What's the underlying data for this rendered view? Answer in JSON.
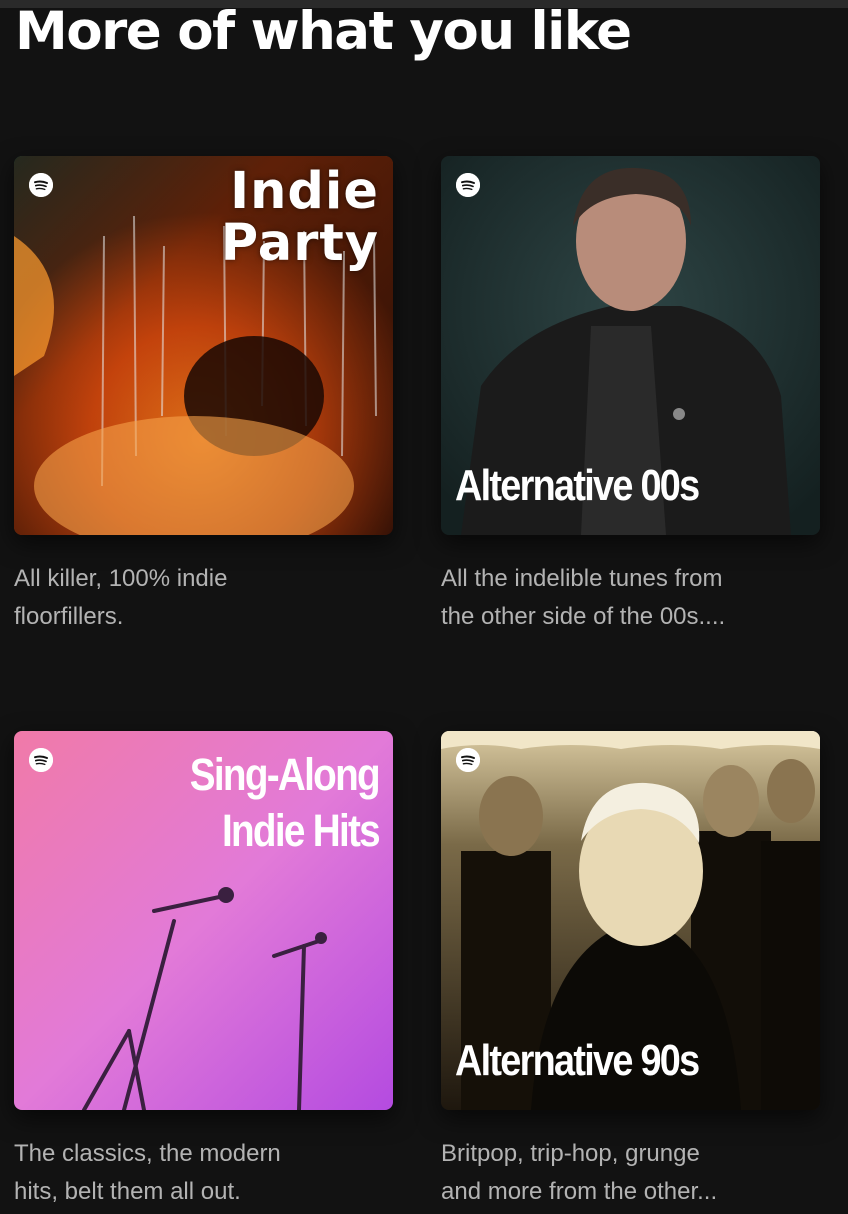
{
  "section": {
    "title": "More of what you like"
  },
  "playlists": [
    {
      "cover_title_line1": "Indie",
      "cover_title_line2": "Party",
      "description_line1": "All killer, 100% indie",
      "description_line2": "floorfillers."
    },
    {
      "cover_title": "Alternative 00s",
      "description_line1": "All the indelible tunes from",
      "description_line2": "the other side of the 00s...."
    },
    {
      "cover_title_line1": "Sing-Along",
      "cover_title_line2": "Indie Hits",
      "description_line1": "The classics, the modern",
      "description_line2": "hits, belt them all out."
    },
    {
      "cover_title": "Alternative 90s",
      "description_line1": "Britpop, trip-hop, grunge",
      "description_line2": "and more from the other..."
    }
  ],
  "icons": {
    "brand_logo": "spotify-logo-icon"
  },
  "colors": {
    "background": "#121212",
    "text_primary": "#ffffff",
    "text_secondary": "#b3b3b3"
  }
}
